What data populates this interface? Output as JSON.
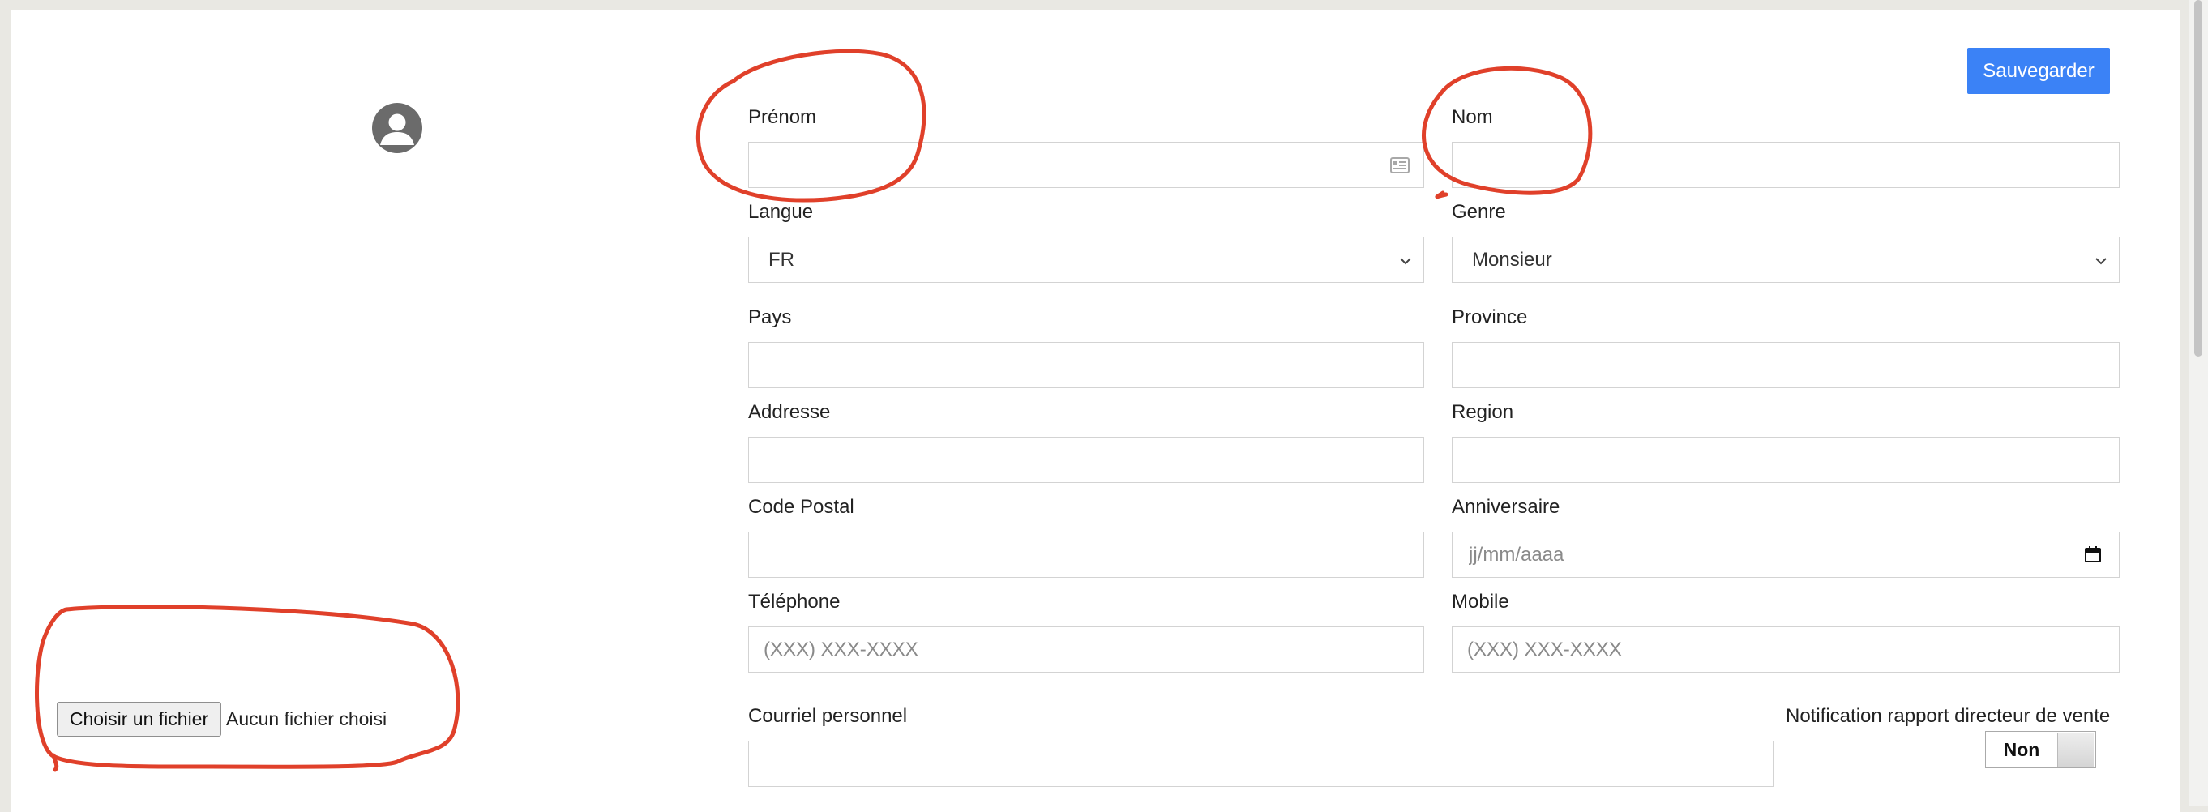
{
  "actions": {
    "save_label": "Sauvegarder"
  },
  "upload": {
    "button_label": "Choisir un fichier",
    "status": "Aucun fichier choisi"
  },
  "form": {
    "prenom": {
      "label": "Prénom",
      "value": ""
    },
    "nom": {
      "label": "Nom",
      "value": ""
    },
    "langue": {
      "label": "Langue",
      "selected": "FR"
    },
    "genre": {
      "label": "Genre",
      "selected": "Monsieur"
    },
    "pays": {
      "label": "Pays",
      "value": ""
    },
    "province": {
      "label": "Province",
      "value": ""
    },
    "addresse": {
      "label": "Addresse",
      "value": ""
    },
    "region": {
      "label": "Region",
      "value": ""
    },
    "code_postal": {
      "label": "Code Postal",
      "value": ""
    },
    "anniversaire": {
      "label": "Anniversaire",
      "placeholder": "jj/mm/aaaa"
    },
    "telephone": {
      "label": "Téléphone",
      "placeholder": "(XXX) XXX-XXXX"
    },
    "mobile": {
      "label": "Mobile",
      "placeholder": "(XXX) XXX-XXXX"
    },
    "courriel": {
      "label": "Courriel personnel",
      "value": ""
    },
    "notification": {
      "label": "Notification rapport directeur de vente",
      "toggle_label": "Non"
    }
  },
  "colors": {
    "accent": "#3b82f6",
    "annotation": "#e0402a"
  }
}
